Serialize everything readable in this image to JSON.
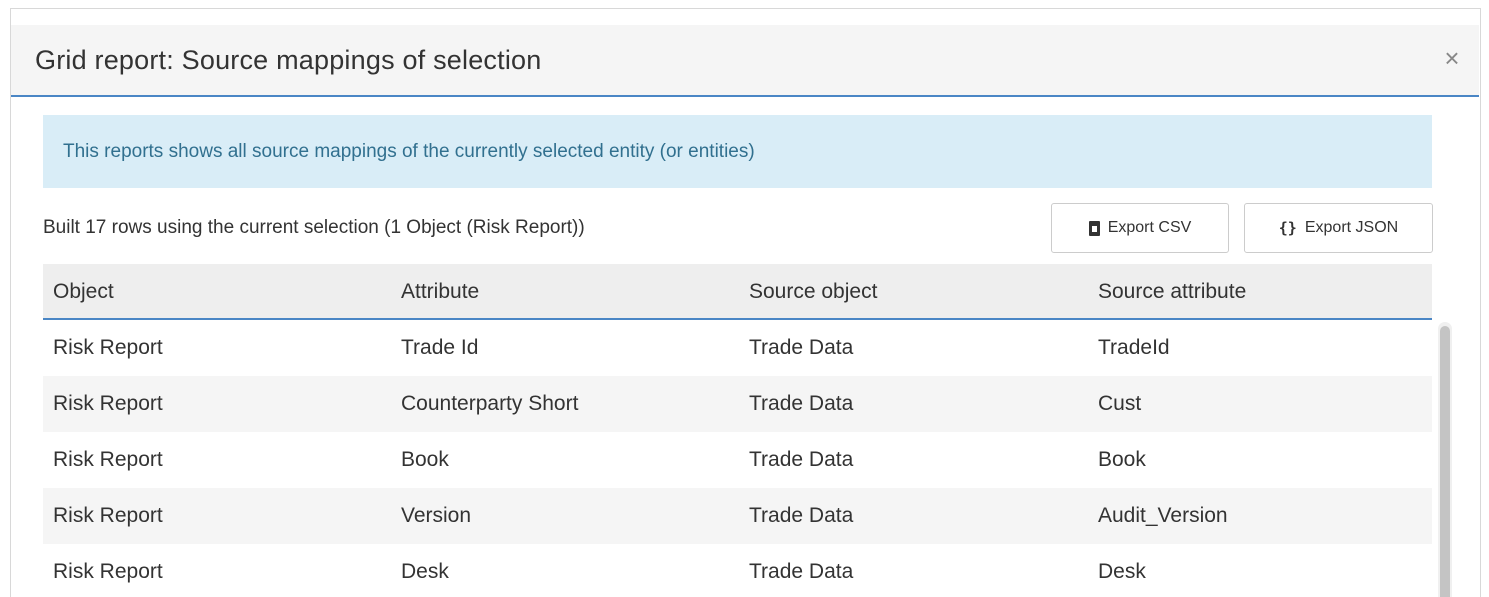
{
  "dialog": {
    "title": "Grid report: Source mappings of selection",
    "close_label": "×",
    "info": "This reports shows all source mappings of the currently selected entity (or entities)",
    "summary": "Built 17 rows using the current selection (1 Object (Risk Report))"
  },
  "buttons": {
    "export_csv": "Export CSV",
    "export_json": "Export JSON",
    "json_icon_glyph": "{}"
  },
  "grid": {
    "columns": [
      "Object",
      "Attribute",
      "Source object",
      "Source attribute"
    ],
    "rows": [
      [
        "Risk Report",
        "Trade Id",
        "Trade Data",
        "TradeId"
      ],
      [
        "Risk Report",
        "Counterparty Short",
        "Trade Data",
        "Cust"
      ],
      [
        "Risk Report",
        "Book",
        "Trade Data",
        "Book"
      ],
      [
        "Risk Report",
        "Version",
        "Trade Data",
        "Audit_Version"
      ],
      [
        "Risk Report",
        "Desk",
        "Trade Data",
        "Desk"
      ]
    ]
  },
  "colors": {
    "accent": "#4a86c5",
    "info_bg": "#d9edf7",
    "info_text": "#31708f"
  },
  "icons": {
    "csv": "file-excel-icon",
    "json": "braces-icon",
    "close": "close-icon"
  }
}
